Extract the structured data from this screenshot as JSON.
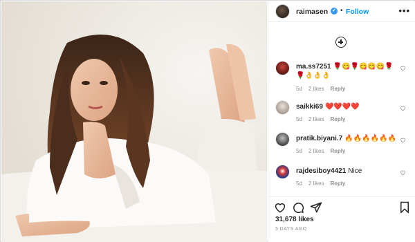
{
  "post": {
    "author": "raimasen",
    "follow_label": "Follow",
    "separator": "•",
    "more_label": "•••",
    "likes_label": "31,678 likes",
    "date_label": "5 DAYS AGO"
  },
  "comments": [
    {
      "user": "ma.ss7251",
      "text": "🌹😋🌹😋😋😋🌹🌹👌👌👌",
      "age": "5d",
      "likes": "2 likes",
      "reply": "Reply"
    },
    {
      "user": "saikki69",
      "text": "❤️❤️❤️❤️",
      "age": "5d",
      "likes": "2 likes",
      "reply": "Reply"
    },
    {
      "user": "pratik.biyani.7",
      "text": "🔥🔥🔥🔥🔥🔥",
      "age": "5d",
      "likes": "2 likes",
      "reply": "Reply"
    },
    {
      "user": "rajdesiboy4421",
      "text": "Nice",
      "age": "5d",
      "likes": "2 likes",
      "reply": "Reply"
    }
  ],
  "colors": {
    "accent": "#0095f6",
    "verified": "#3897f0",
    "muted": "#8e8e8e",
    "text": "#262626"
  },
  "icons": [
    "verified-badge-icon",
    "more-options-icon",
    "load-more-icon",
    "heart-icon",
    "comment-icon",
    "share-icon",
    "bookmark-icon"
  ]
}
